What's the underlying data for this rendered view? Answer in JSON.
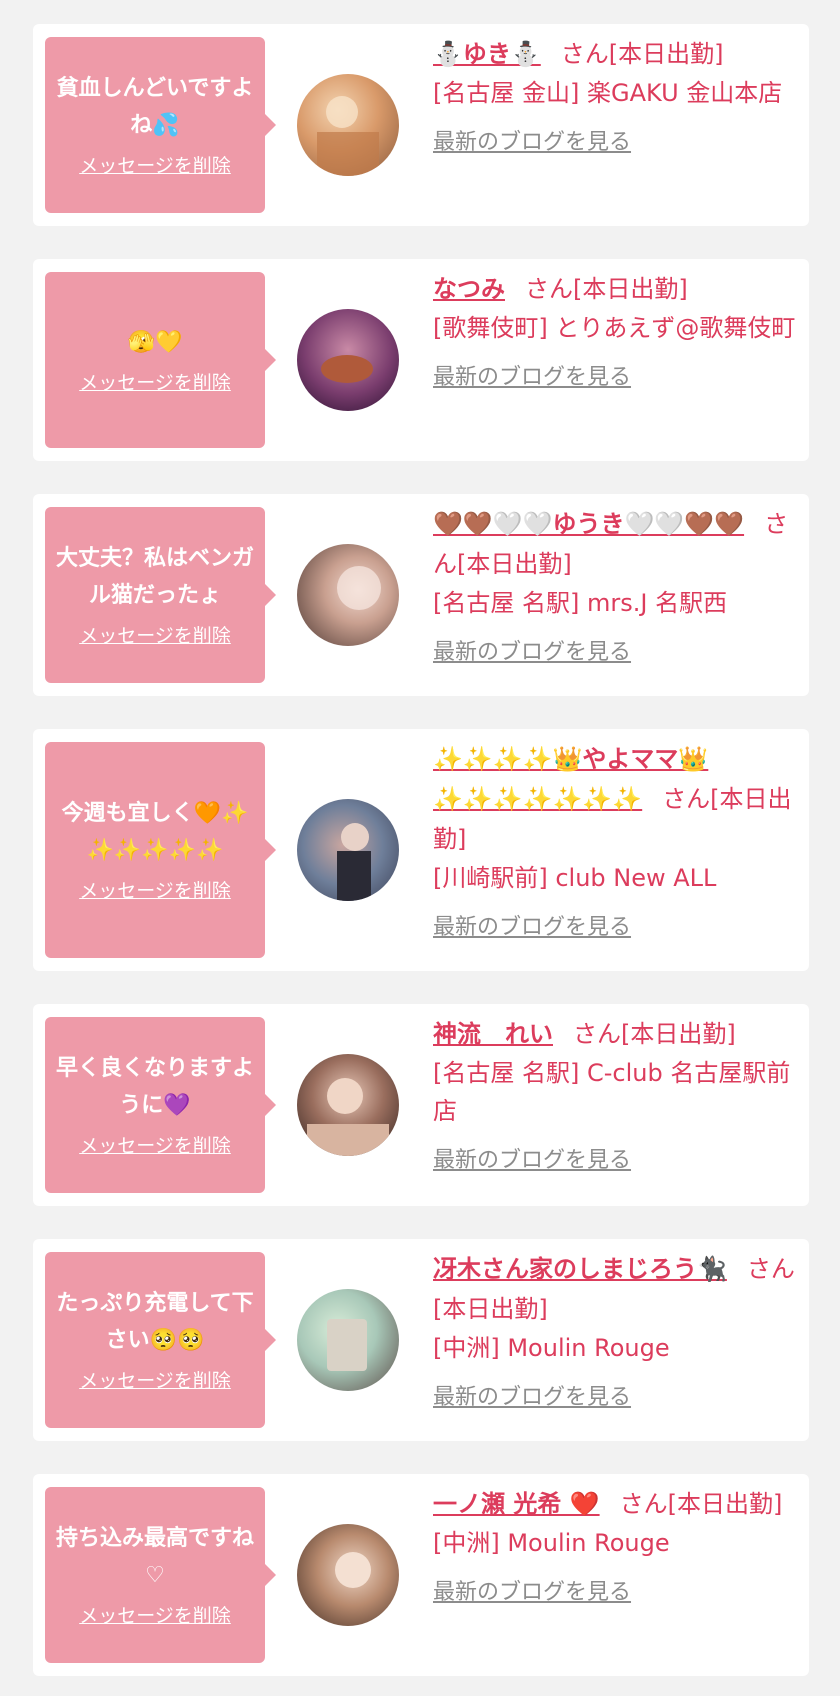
{
  "delete_label": "メッセージを削除",
  "blog_label": "最新のブログを見る",
  "status_suffix": "さん[本日出勤]",
  "colors": {
    "accent": "#dc3c5c",
    "bubble": "#ee9aa8",
    "link_gray": "#8c8c8c",
    "background": "#f2f2f2"
  },
  "messages": [
    {
      "message": "貧血しんどいですよね💦",
      "name": "⛄ゆき⛄",
      "shop": "[名古屋 金山] 楽GAKU 金山本店",
      "avatar_icon": "photo-avatar-icon"
    },
    {
      "message": "🫣💛",
      "name": "なつみ",
      "shop": "[歌舞伎町] とりあえず@歌舞伎町",
      "avatar_icon": "photo-avatar-icon"
    },
    {
      "message": "大丈夫？私はベンガル猫だったょ",
      "name": "🤎🤎🤍🤍ゆうき🤍🤍🤎🤎",
      "shop": "[名古屋 名駅] mrs.J 名駅西",
      "avatar_icon": "photo-avatar-icon"
    },
    {
      "message": "今週も宜しく🧡✨✨✨✨✨✨",
      "name": "✨✨✨✨👑やよママ👑✨✨✨✨✨✨✨",
      "shop": "[川崎駅前] club New ALL",
      "avatar_icon": "photo-avatar-icon"
    },
    {
      "message": "早く良くなりますように💜",
      "name": "神流　れい",
      "shop": "[名古屋 名駅] C-club 名古屋駅前店",
      "avatar_icon": "photo-avatar-icon"
    },
    {
      "message": "たっぷり充電して下さい🥺🥺",
      "name": "冴木さん家のしまじろう🐈‍⬛",
      "shop": "[中洲] Moulin Rouge",
      "avatar_icon": "photo-avatar-icon"
    },
    {
      "message": "持ち込み最高ですね♡",
      "name": "一ノ瀬 光希 ❤️",
      "shop": "[中洲] Moulin Rouge",
      "avatar_icon": "photo-avatar-icon"
    }
  ]
}
